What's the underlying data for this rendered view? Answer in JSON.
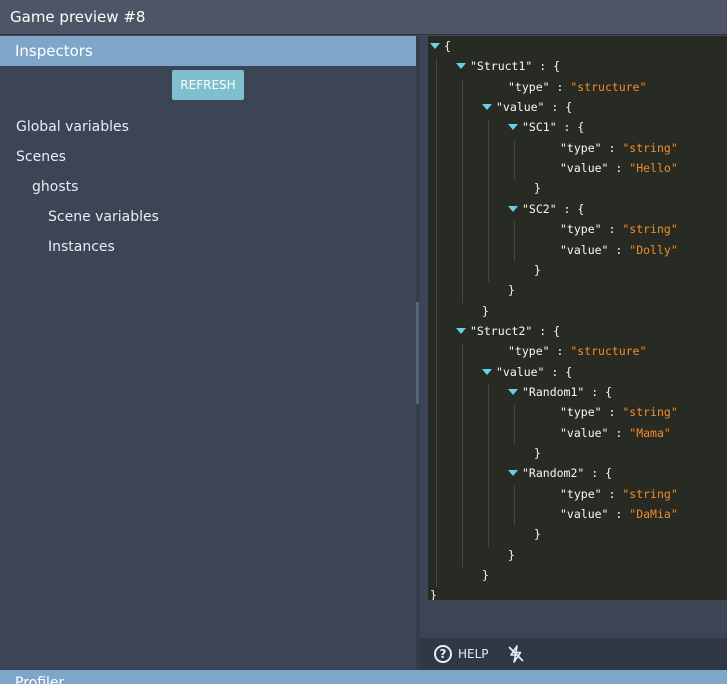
{
  "window": {
    "title": "Game preview #8"
  },
  "inspectors": {
    "header": "Inspectors",
    "refresh_label": "REFRESH",
    "tree": [
      {
        "label": "Global variables",
        "level": 0
      },
      {
        "label": "Scenes",
        "level": 0
      },
      {
        "label": "ghosts",
        "level": 1
      },
      {
        "label": "Scene variables",
        "level": 2
      },
      {
        "label": "Instances",
        "level": 2
      }
    ]
  },
  "json_view": {
    "Struct1": {
      "type": "structure",
      "value": {
        "SC1": {
          "type": "string",
          "value": "Hello"
        },
        "SC2": {
          "type": "string",
          "value": "Dolly"
        }
      }
    },
    "Struct2": {
      "type": "structure",
      "value": {
        "Random1": {
          "type": "string",
          "value": "Mama"
        },
        "Random2": {
          "type": "string",
          "value": "DaMia"
        }
      }
    }
  },
  "toolbar": {
    "help_label": "HELP",
    "help_icon": "question-circle-icon",
    "debug_icon": "lightning-off-icon"
  },
  "profiler": {
    "header": "Profiler"
  },
  "colors": {
    "accent": "#7ea6c9",
    "refresh": "#7ec0ce",
    "json_string": "#f28c28",
    "json_caret": "#67d0e8"
  }
}
